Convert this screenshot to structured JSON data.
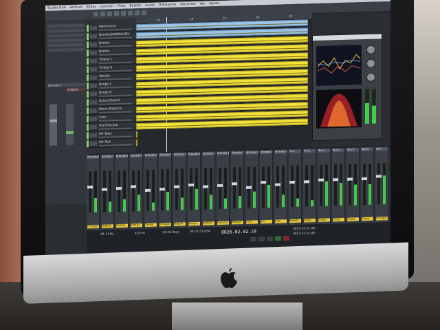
{
  "window": {
    "title": "Studio One",
    "menu": [
      "Studio One",
      "Archivo",
      "Editar",
      "Canción",
      "Pista",
      "Evento",
      "Audio",
      "Transporte",
      "Opciones",
      "Ver",
      "Ayuda"
    ]
  },
  "inspector": {
    "label": "Entrada 1",
    "channel": "PENDIA"
  },
  "tracks": [
    {
      "name": "Metrónomo"
    },
    {
      "name": "Bombo(SONIDO-BD)"
    },
    {
      "name": "Bombo"
    },
    {
      "name": "Bombo"
    },
    {
      "name": "Timbal 1"
    },
    {
      "name": "Timbal 8"
    },
    {
      "name": "Versión"
    },
    {
      "name": "Bongo 1"
    },
    {
      "name": "Bongo 8"
    },
    {
      "name": "Guitar Electric"
    },
    {
      "name": "Ritmo Electrico"
    },
    {
      "name": "Coro"
    },
    {
      "name": "Voz Principal"
    },
    {
      "name": "Gtr Bass"
    },
    {
      "name": "Gtr Test"
    }
  ],
  "mixer": {
    "strips": [
      {
        "label": "Entrada 17",
        "name": "Principal",
        "level": 0.62,
        "meter": 0.35
      },
      {
        "label": "Entrada 9",
        "name": "PENDIA",
        "level": 0.55,
        "meter": 0.25
      },
      {
        "label": "Entrada 3",
        "name": "PENDIA",
        "level": 0.58,
        "meter": 0.3
      },
      {
        "label": "Entrada 10",
        "name": "PENDIA",
        "level": 0.6,
        "meter": 0.4
      },
      {
        "label": "Entrada 5",
        "name": "Timbal",
        "level": 0.5,
        "meter": 0.2
      },
      {
        "label": "Entrada 8",
        "name": "Timbales",
        "level": 0.52,
        "meter": 0.45
      },
      {
        "label": "Entrada 11",
        "name": "PENDIA",
        "level": 0.57,
        "meter": 0.3
      },
      {
        "label": "Entrada 12",
        "name": "Bongos",
        "level": 0.6,
        "meter": 0.5
      },
      {
        "label": "Entrada 13",
        "name": "PENDIA",
        "level": 0.55,
        "meter": 0.35
      },
      {
        "label": "Entrada 14",
        "name": "Guitarra",
        "level": 0.58,
        "meter": 0.25
      },
      {
        "label": "Entrada 15",
        "name": "PENDIA",
        "level": 0.6,
        "meter": 0.3
      },
      {
        "label": "Entrada 16",
        "name": "Coro",
        "level": 0.5,
        "meter": 0.4
      },
      {
        "label": "Entrada 18",
        "name": "Voz",
        "level": 0.62,
        "meter": 0.55
      },
      {
        "label": "Entrada 19",
        "name": "Bajo",
        "level": 0.55,
        "meter": 0.3
      },
      {
        "label": "FX 1",
        "name": "Reverb",
        "level": 0.6,
        "meter": 0.2
      },
      {
        "label": "FX 2",
        "name": "Delay",
        "level": 0.6,
        "meter": 0.15
      },
      {
        "label": "Bus 1",
        "name": "Grupo",
        "level": 0.65,
        "meter": 0.6
      },
      {
        "label": "Bus 2",
        "name": "Grupo",
        "level": 0.65,
        "meter": 0.55
      },
      {
        "label": "Bus 3",
        "name": "Grupo",
        "level": 0.65,
        "meter": 0.5
      },
      {
        "label": "Bus 4",
        "name": "Grupo",
        "level": 0.65,
        "meter": 0.5
      },
      {
        "label": "Main",
        "name": "Principal",
        "level": 0.7,
        "meter": 0.7
      }
    ]
  },
  "transport": {
    "sample_rate": "44.1 kHz",
    "cpu": "4.8 ms",
    "record": "14:18 days",
    "position": "00:01:53.834",
    "time": "0026.02.02.19",
    "loop_start": "0025.01.01.00",
    "loop_end": "0037.01.01.00"
  },
  "colors": {
    "clip_yellow": "#f2e23a",
    "clip_blue": "#9cc3e8",
    "strip_name": "#e6c83a"
  }
}
